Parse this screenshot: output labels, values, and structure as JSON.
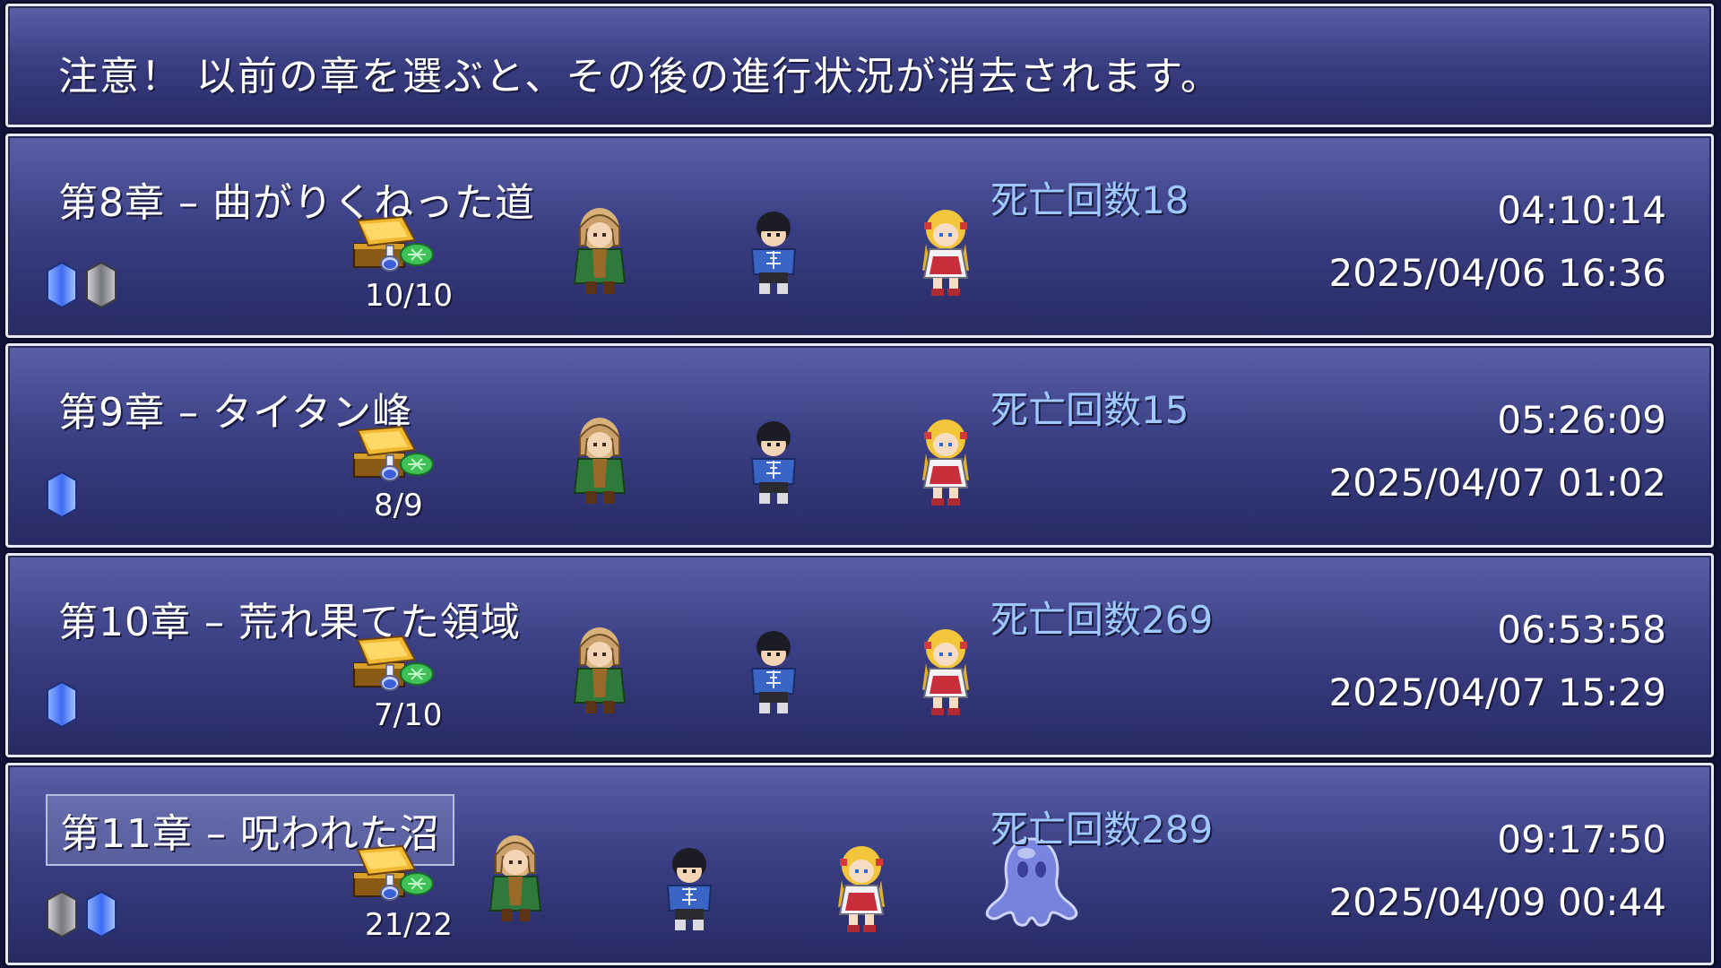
{
  "notice": {
    "text": "注意！ 以前の章を選ぶと、その後の進行状況が消去されます。"
  },
  "colors": {
    "window_top": "#5a5fa6",
    "window_bottom": "#272a63",
    "window_border": "#e6e8f4",
    "death_text": "#9ec8ff",
    "crystal_blue": "#5b8cff",
    "crystal_gray": "#9a9aa0"
  },
  "saves": [
    {
      "chapter": "第8章 – 曲がりくねった道",
      "deaths": "死亡回数18",
      "playtime": "04:10:14",
      "date": "2025/04/06 16:36",
      "treasure": "10/10",
      "crystals": [
        "blue",
        "gray"
      ],
      "party": [
        "ranger-icon",
        "boy-icon",
        "girl-icon"
      ],
      "selected": false
    },
    {
      "chapter": "第9章 – タイタン峰",
      "deaths": "死亡回数15",
      "playtime": "05:26:09",
      "date": "2025/04/07 01:02",
      "treasure": "8/9",
      "crystals": [
        "blue"
      ],
      "party": [
        "ranger-icon",
        "boy-icon",
        "girl-icon"
      ],
      "selected": false
    },
    {
      "chapter": "第10章 – 荒れ果てた領域",
      "deaths": "死亡回数269",
      "playtime": "06:53:58",
      "date": "2025/04/07 15:29",
      "treasure": "7/10",
      "crystals": [
        "blue"
      ],
      "party": [
        "ranger-icon",
        "boy-icon",
        "girl-icon"
      ],
      "selected": false
    },
    {
      "chapter": "第11章 – 呪われた沼",
      "deaths": "死亡回数289",
      "playtime": "09:17:50",
      "date": "2025/04/09 00:44",
      "treasure": "21/22",
      "crystals": [
        "gray",
        "blue"
      ],
      "party": [
        "ranger-icon",
        "boy-icon",
        "girl-icon",
        "water-spirit-icon"
      ],
      "selected": true
    }
  ]
}
